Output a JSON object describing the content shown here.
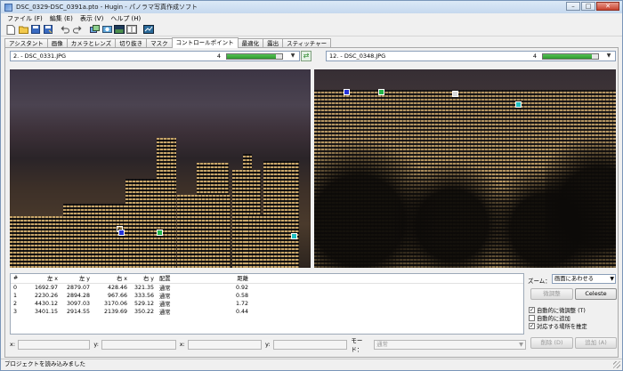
{
  "window": {
    "title": "DSC_0329-DSC_0391a.pto - Hugin - パノラマ写真作成ソフト",
    "buttons": {
      "minimize": "–",
      "maximize": "□",
      "close": "✕"
    }
  },
  "menu": [
    "ファイル (F)",
    "編集 (E)",
    "表示 (V)",
    "ヘルプ (H)"
  ],
  "toolbar_icons": [
    "new-icon",
    "open-icon",
    "save-icon",
    "save-as-icon",
    "undo-icon",
    "redo-icon",
    "images-icon",
    "lens-icon",
    "preview-icon",
    "fast-preview-icon",
    "control-points-icon",
    "optimize-icon"
  ],
  "tabs": [
    "アシスタント",
    "画像",
    "カメラとレンズ",
    "切り抜き",
    "マスク",
    "コントロールポイント",
    "最適化",
    "露出",
    "スティッチャー"
  ],
  "active_tab": "コントロールポイント",
  "left_image": {
    "name": "2. - DSC_0331.JPG",
    "count": "4",
    "progress": 0.88
  },
  "right_image": {
    "name": "12. - DSC_0348.JPG",
    "count": "4",
    "progress": 0.88
  },
  "swap_glyph": "⇄",
  "colors": {
    "progress": "#3fa83f",
    "cp0": "#2533d8",
    "cp1": "#22b64a",
    "cp2": "#20c0c0",
    "cp3": "#d9d9d9"
  },
  "table": {
    "headers": [
      "#",
      "左 x",
      "左 y",
      "右 x",
      "右 y",
      "配置",
      "距離"
    ],
    "rows": [
      [
        "0",
        "1692.97",
        "2879.07",
        "428.46",
        "321.35",
        "通常",
        "0.92"
      ],
      [
        "1",
        "2230.26",
        "2894.28",
        "967.66",
        "333.56",
        "通常",
        "0.58"
      ],
      [
        "2",
        "4430.12",
        "3097.03",
        "3170.06",
        "529.12",
        "通常",
        "1.72"
      ],
      [
        "3",
        "3401.15",
        "2914.55",
        "2139.69",
        "350.22",
        "通常",
        "0.44"
      ]
    ]
  },
  "cp_labels": [
    "0",
    "1",
    "2",
    "3"
  ],
  "side": {
    "zoom_label": "ズーム：",
    "zoom_value": "画面にあわせる",
    "fine_tune": "微調整",
    "celeste": "Celeste",
    "checks": [
      {
        "label": "自動的に微調整 (T)",
        "checked": true
      },
      {
        "label": "自動的に追加",
        "checked": false
      },
      {
        "label": "対応する場所を推定",
        "checked": true
      }
    ],
    "delete": "削除 (D)",
    "add": "追加 (A)"
  },
  "coords": {
    "x": "x:",
    "y": "y:",
    "x2": "x:",
    "y2": "y:",
    "mode_label": "モード：",
    "mode_value": "通常"
  },
  "status": "プロジェクトを読み込みました"
}
